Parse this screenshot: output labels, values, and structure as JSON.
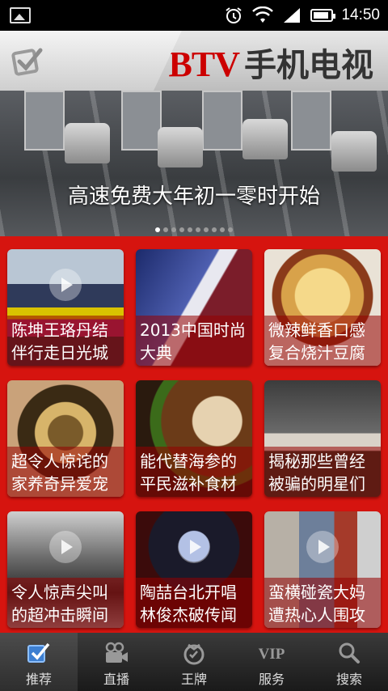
{
  "status_bar": {
    "time": "14:50"
  },
  "app_bar": {
    "logo_latin": "BTV",
    "logo_cn": "手机电视"
  },
  "hero": {
    "caption": "高速免费大年初一零时开始",
    "page_count": 10,
    "active_index": 0
  },
  "grid": {
    "items": [
      {
        "title": "陈坤王珞丹结伴行走日光城",
        "has_play": true
      },
      {
        "title": "2013中国时尚大典",
        "has_play": false
      },
      {
        "title": "微辣鲜香口感复合烧汁豆腐",
        "has_play": false
      },
      {
        "title": "超令人惊诧的家养奇异爱宠",
        "has_play": false
      },
      {
        "title": "能代替海参的平民滋补食材",
        "has_play": false
      },
      {
        "title": "揭秘那些曾经被骗的明星们",
        "has_play": false
      },
      {
        "title": "令人惊声尖叫的超冲击瞬间",
        "has_play": true
      },
      {
        "title": "陶喆台北开唱林俊杰破传闻",
        "has_play": true
      },
      {
        "title": "蛮横碰瓷大妈遭热心人围攻",
        "has_play": true
      }
    ]
  },
  "tabs": [
    {
      "label": "推荐",
      "icon": "recommend-icon",
      "active": true
    },
    {
      "label": "直播",
      "icon": "camera-icon",
      "active": false
    },
    {
      "label": "王牌",
      "icon": "ace-icon",
      "active": false
    },
    {
      "label": "服务",
      "icon": "vip-icon",
      "active": false
    },
    {
      "label": "搜索",
      "icon": "search-icon",
      "active": false
    }
  ]
}
